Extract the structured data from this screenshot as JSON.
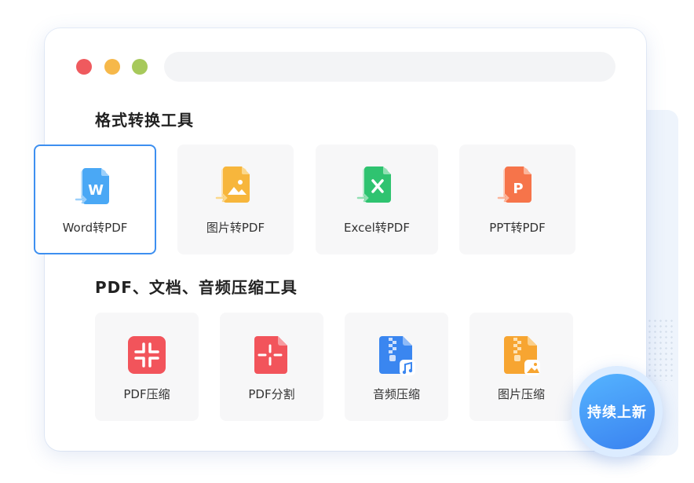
{
  "sections": [
    {
      "title": "格式转换工具",
      "tiles": [
        {
          "label": "Word转PDF",
          "icon": "word-to-pdf-icon",
          "color": "#4aa8f5",
          "selected": true
        },
        {
          "label": "图片转PDF",
          "icon": "image-to-pdf-icon",
          "color": "#f7b63c",
          "selected": false
        },
        {
          "label": "Excel转PDF",
          "icon": "excel-to-pdf-icon",
          "color": "#2fc370",
          "selected": false
        },
        {
          "label": "PPT转PDF",
          "icon": "ppt-to-pdf-icon",
          "color": "#f6744a",
          "selected": false
        }
      ]
    },
    {
      "title": "PDF、文档、音频压缩工具",
      "tiles": [
        {
          "label": "PDF压缩",
          "icon": "pdf-compress-icon",
          "color": "#f2545b"
        },
        {
          "label": "PDF分割",
          "icon": "pdf-split-icon",
          "color": "#f2545b"
        },
        {
          "label": "音频压缩",
          "icon": "audio-compress-icon",
          "color": "#3a86f0"
        },
        {
          "label": "图片压缩",
          "icon": "image-compress-icon",
          "color": "#f7a531"
        }
      ]
    }
  ],
  "badge": {
    "label": "持续上新"
  },
  "colors": {
    "accent": "#3d8ff0"
  }
}
